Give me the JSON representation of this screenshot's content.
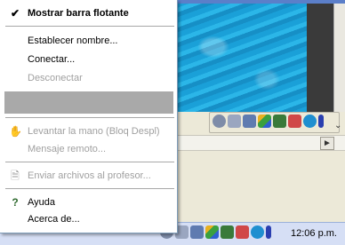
{
  "menu": {
    "items": [
      {
        "label": "Mostrar barra flotante",
        "checked": true,
        "bold": true,
        "enabled": true
      },
      {
        "label": "Establecer nombre...",
        "enabled": true
      },
      {
        "label": "Conectar...",
        "enabled": true
      },
      {
        "label": "Desconectar",
        "enabled": false
      },
      {
        "label": "Levantar la mano (Bloq Despl)",
        "enabled": false
      },
      {
        "label": "Mensaje remoto...",
        "enabled": false
      },
      {
        "label": "Enviar archivos al profesor...",
        "enabled": false
      },
      {
        "label": "Ayuda",
        "enabled": true
      },
      {
        "label": "Acerca de...",
        "enabled": true
      }
    ]
  },
  "taskbar": {
    "clock": "12:06 p.m."
  },
  "icons": {
    "check": "checkmark-icon",
    "hand": "raise-hand-icon",
    "send": "send-files-icon",
    "help": "help-icon"
  },
  "colors": {
    "menu_highlight": "#a9a9a9",
    "disabled_text": "#a0a0a0",
    "water": "#1aa0d8"
  }
}
